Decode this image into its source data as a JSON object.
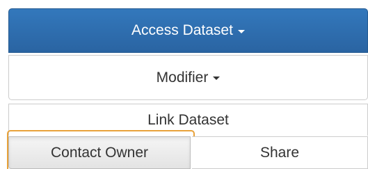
{
  "buttons": {
    "access_dataset": "Access Dataset",
    "modifier": "Modifier",
    "link_dataset": "Link Dataset",
    "contact_owner": "Contact Owner",
    "share": "Share"
  },
  "icons": {
    "access_dataset_caret": "chevron-down-icon",
    "modifier_caret": "chevron-down-icon"
  },
  "colors": {
    "primary": "#2a6aad",
    "focus_ring": "#e8a23a"
  }
}
